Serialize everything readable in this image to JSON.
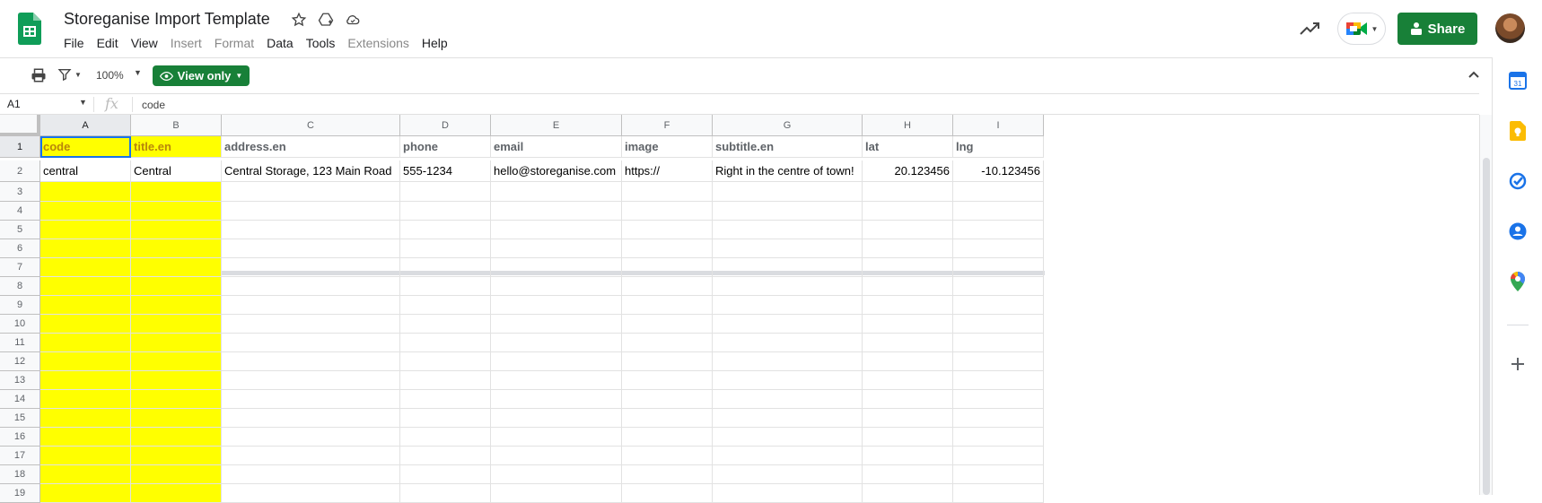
{
  "header": {
    "title": "Storeganise Import Template",
    "menu": [
      {
        "label": "File",
        "disabled": false
      },
      {
        "label": "Edit",
        "disabled": false
      },
      {
        "label": "View",
        "disabled": false
      },
      {
        "label": "Insert",
        "disabled": true
      },
      {
        "label": "Format",
        "disabled": true
      },
      {
        "label": "Data",
        "disabled": false
      },
      {
        "label": "Tools",
        "disabled": false
      },
      {
        "label": "Extensions",
        "disabled": true
      },
      {
        "label": "Help",
        "disabled": false
      }
    ],
    "share_label": "Share"
  },
  "toolbar": {
    "zoom": "100%",
    "view_only_label": "View only"
  },
  "formula_bar": {
    "name_box": "A1",
    "fx": "fx",
    "content": "code"
  },
  "sheet": {
    "columns": [
      "A",
      "B",
      "C",
      "D",
      "E",
      "F",
      "G",
      "H",
      "I"
    ],
    "rows": [
      [
        "code",
        "title.en",
        "address.en",
        "phone",
        "email",
        "image",
        "subtitle.en",
        "lat",
        "lng"
      ],
      [
        "central",
        "Central",
        "Central Storage, 123 Main Road",
        "555-1234",
        "hello@storeganise.com",
        "https://",
        "Right in the centre of town!",
        "20.123456",
        "-10.123456"
      ]
    ],
    "row_numbers": [
      "1",
      "2",
      "3",
      "4",
      "5",
      "6",
      "7",
      "8",
      "9",
      "10",
      "11",
      "12",
      "13",
      "14",
      "15",
      "16",
      "17",
      "18",
      "19"
    ],
    "highlight_color": "#ffff00"
  },
  "colors": {
    "brand_green": "#188038",
    "selection_blue": "#1a73e8"
  }
}
